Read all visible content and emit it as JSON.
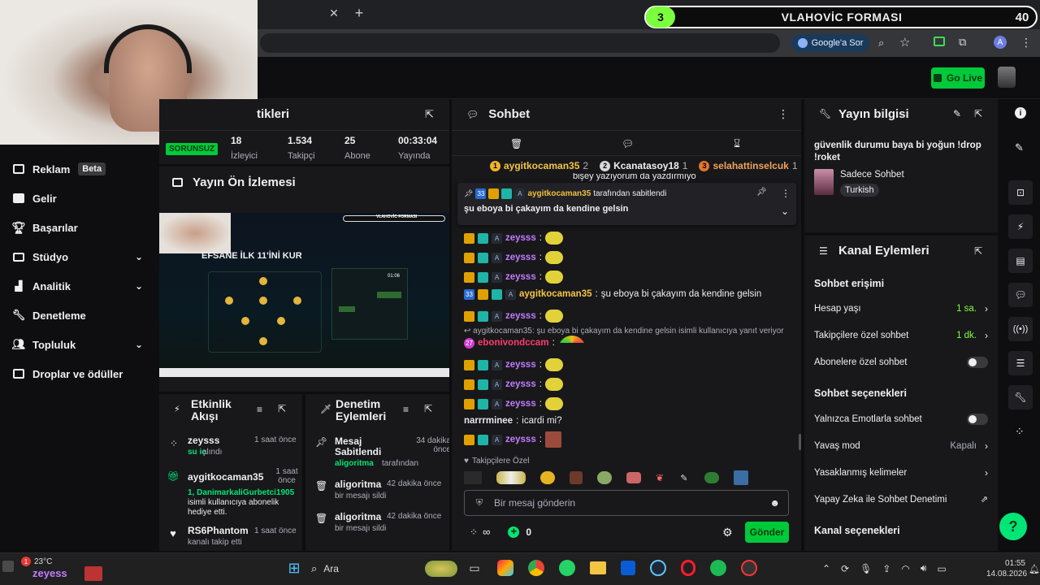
{
  "browser": {
    "google_sor": "Google'a Sor",
    "profile_initial": "A"
  },
  "overlay_banner": {
    "number": "3",
    "title": "VLAHOVİC FORMASI",
    "count": "40"
  },
  "header": {
    "go_live": "Go Live"
  },
  "sidebar": {
    "items": [
      {
        "label": "Reklam",
        "badge": "Beta"
      },
      {
        "label": "Gelir"
      },
      {
        "label": "Başarılar"
      },
      {
        "label": "Stüdyo"
      },
      {
        "label": "Analitik"
      },
      {
        "label": "Denetleme"
      },
      {
        "label": "Topluluk"
      },
      {
        "label": "Droplar ve ödüller"
      }
    ]
  },
  "stats": {
    "title_fragment": "tikleri",
    "status": "SORUNSUZ",
    "cells": [
      {
        "value": "18",
        "label": "İzleyici"
      },
      {
        "value": "1.534",
        "label": "Takipçi"
      },
      {
        "value": "25",
        "label": "Abone"
      },
      {
        "value": "00:33:04",
        "label": "Yayında"
      }
    ]
  },
  "preview": {
    "title": "Yayın Ön İzlemesi",
    "headline": "EFSANE İLK 11'İNİ KUR",
    "banner": "VLAHOVİC FORMASI",
    "timer": "01:06"
  },
  "activity": {
    "title_line1": "Etkinlik",
    "title_line2": "Akışı",
    "items": [
      {
        "user": "zeysss",
        "time": "1 saat önce",
        "detail": "su iç",
        "detail2": "alındı"
      },
      {
        "user": "aygitkocaman35",
        "time": "1 saat önce",
        "detail": "1, DanimarkaliGurbetci1905",
        "detail2": "isimli kullanıcıya abonelik hediye etti."
      },
      {
        "user": "RS6Phantom",
        "time": "1 saat önce",
        "detail": "kanalı takip etti"
      }
    ]
  },
  "moderation": {
    "title_line1": "Denetim",
    "title_line2": "Eylemleri",
    "items": [
      {
        "title": "Mesaj Sabitlendi",
        "time": "34 dakika önce",
        "actor": "aligoritma",
        "suffix": "tarafından"
      },
      {
        "title": "aligoritma",
        "time": "42 dakika önce",
        "detail": "bir mesajı sildi"
      },
      {
        "title": "aligoritma",
        "time": "42 dakika önce",
        "detail": "bir mesajı sildi"
      }
    ]
  },
  "chat": {
    "title": "Sohbet",
    "leaders": [
      {
        "rank": "1",
        "name": "aygitkocaman35",
        "count": "2"
      },
      {
        "rank": "2",
        "name": "Kcanatasoy18",
        "count": "1"
      },
      {
        "rank": "3",
        "name": "selahattinselcuk",
        "count": "1"
      }
    ],
    "top_cut_text": "bişey yazıyorum da yazdırmıyo",
    "pinned": {
      "badge_num": "33",
      "user": "aygitkocaman35",
      "by": "tarafından sabitlendi",
      "text": "şu eboya bi çakayım da kendine gelsin"
    },
    "messages": [
      {
        "user": "zeysss",
        "text": ""
      },
      {
        "user": "zeysss",
        "text": ""
      },
      {
        "user": "zeysss",
        "text": ""
      },
      {
        "user": "aygitkocaman35",
        "text": "şu eboya bi çakayım da kendine gelsin",
        "badge_num": "33"
      },
      {
        "user": "zeysss",
        "text": ""
      }
    ],
    "reply_note": "aygitkocaman35: şu eboya bi çakayım da kendine gelsin isimli kullanıcıya yanıt veriyor",
    "reply_user": "ebonivondccam",
    "reply_badge": "27",
    "messages2": [
      {
        "user": "zeysss"
      },
      {
        "user": "zeysss"
      },
      {
        "user": "zeysss"
      }
    ],
    "narr": {
      "user": "narrrminee",
      "text": "icardi mi?"
    },
    "last_user": "zeysss",
    "followers_only": "Takipçilere Özel",
    "input_placeholder": "Bir mesaj gönderin",
    "points": "0",
    "send": "Gönder"
  },
  "stream_info": {
    "title": "Yayın bilgisi",
    "text": "güvenlik durumu baya bi yoğun !drop !roket",
    "category": "Sadece Sohbet",
    "tag": "Turkish"
  },
  "channel_actions": {
    "title": "Kanal Eylemleri",
    "section1": "Sohbet erişimi",
    "rows1": [
      {
        "label": "Hesap yaşı",
        "value": "1 sa."
      },
      {
        "label": "Takipçilere özel sohbet",
        "value": "1 dk."
      },
      {
        "label": "Abonelere özel sohbet",
        "value": ""
      }
    ],
    "section2": "Sohbet seçenekleri",
    "rows2": [
      {
        "label": "Yalnızca Emotlarla sohbet",
        "value": ""
      },
      {
        "label": "Yavaş mod",
        "value": "Kapalı"
      },
      {
        "label": "Yasaklanmış kelimeler",
        "value": ""
      },
      {
        "label": "Yapay Zeka ile Sohbet Denetimi",
        "value": ""
      }
    ],
    "section3": "Kanal seçenekleri"
  },
  "taskbar": {
    "weather": "23°C",
    "search": "Ara",
    "time": "01:55",
    "date": "14.08.2026",
    "app_label": "zeyess",
    "notif": "1"
  },
  "colors": {
    "accent": "#00e676",
    "brand": "#53fc18",
    "bg": "#0e0e10",
    "panel": "#18181b"
  }
}
